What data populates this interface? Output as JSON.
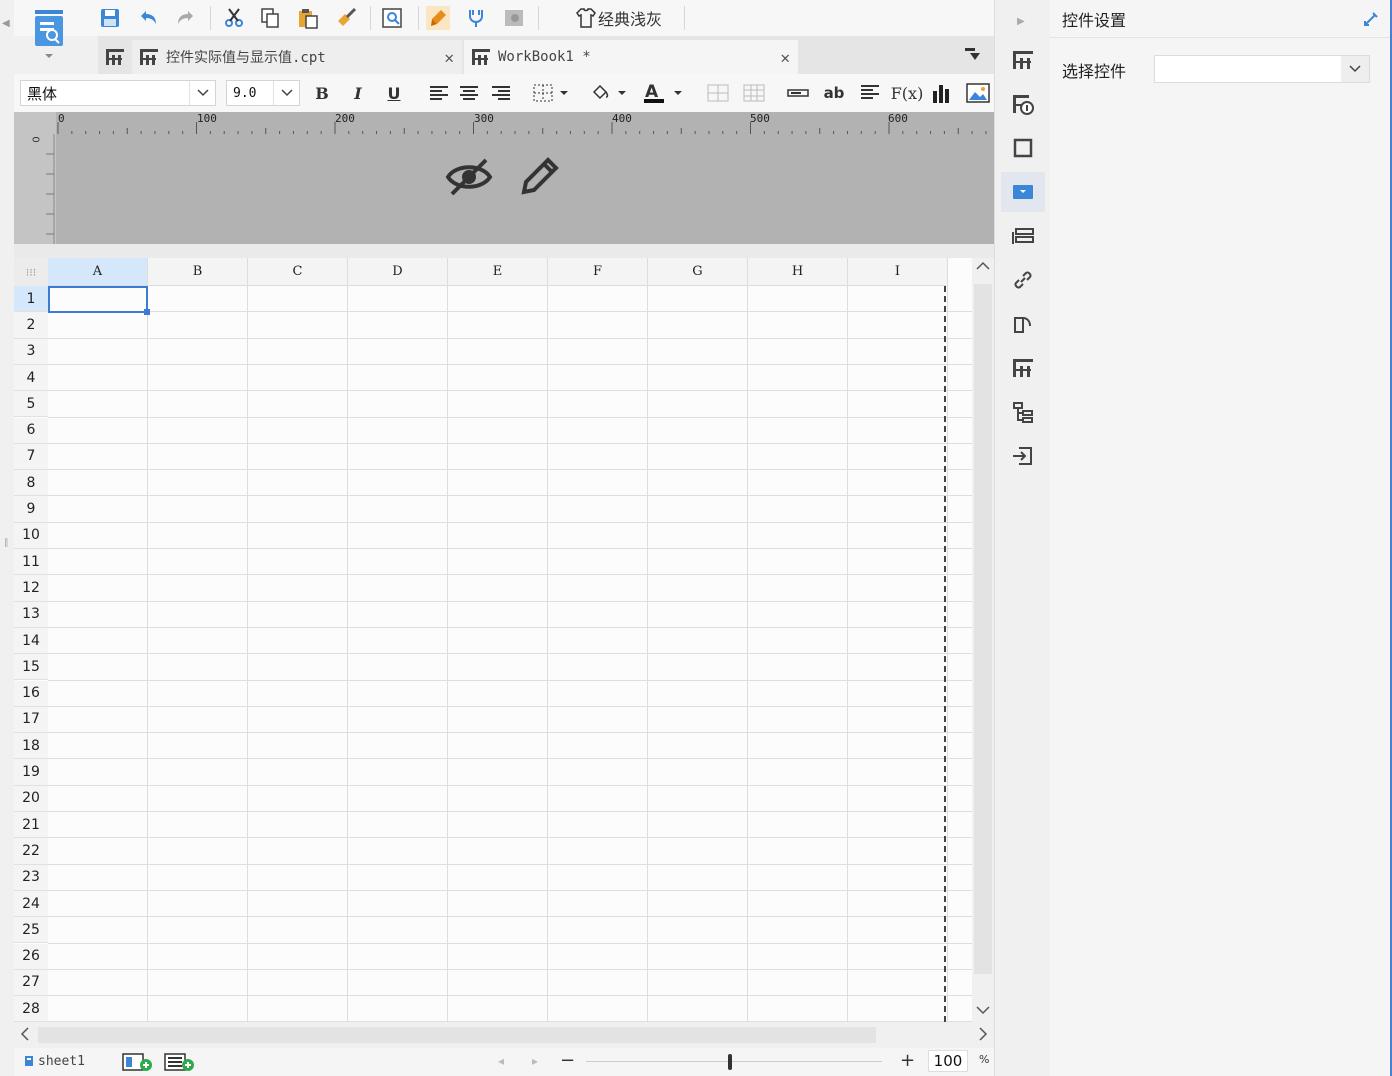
{
  "toolbar": {
    "skin_label": "经典浅灰"
  },
  "tabs": [
    {
      "label": "控件实际值与显示值.cpt"
    },
    {
      "label": "WorkBook1 *"
    }
  ],
  "format": {
    "font_name": "黑体",
    "font_size": "9.0",
    "bold_label": "B",
    "italic_label": "I",
    "underline_label": "U",
    "wrap_label": "ab",
    "formula_label": "F(x)"
  },
  "ruler": {
    "ticks": [
      "0",
      "100",
      "200",
      "300",
      "400",
      "500",
      "600"
    ],
    "vertical_zero": "0"
  },
  "grid": {
    "columns": [
      "A",
      "B",
      "C",
      "D",
      "E",
      "F",
      "G",
      "H",
      "I"
    ],
    "rows": [
      "1",
      "2",
      "3",
      "4",
      "5",
      "6",
      "7",
      "8",
      "9",
      "10",
      "11",
      "12",
      "13",
      "14",
      "15",
      "16",
      "17",
      "18",
      "19",
      "20",
      "21",
      "22",
      "23",
      "24",
      "25",
      "26",
      "27",
      "28"
    ],
    "selected_cell": "A1"
  },
  "bottom": {
    "sheet_name": "sheet1",
    "zoom_value": "100",
    "zoom_unit": "%"
  },
  "panel": {
    "title": "控件设置",
    "select_label": "选择控件",
    "select_value": ""
  },
  "colors": {
    "accent": "#3b7bd4",
    "header_bg": "#b2b2b2",
    "selected_header": "#d4e7fb"
  }
}
